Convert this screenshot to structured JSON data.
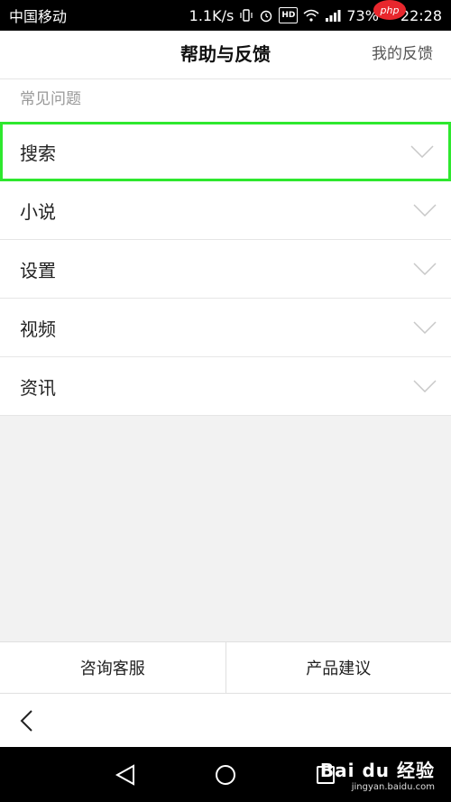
{
  "status_bar": {
    "carrier": "中国移动",
    "network_speed": "1.1K/s",
    "hd_label": "HD",
    "battery": "73%",
    "time": "22:28",
    "php_badge": "php"
  },
  "header": {
    "title": "帮助与反馈",
    "my_feedback": "我的反馈"
  },
  "faq": {
    "section_label": "常见问题",
    "items": [
      {
        "label": "搜索",
        "selected": true
      },
      {
        "label": "小说",
        "selected": false
      },
      {
        "label": "设置",
        "selected": false
      },
      {
        "label": "视频",
        "selected": false
      },
      {
        "label": "资讯",
        "selected": false
      }
    ]
  },
  "bottom_actions": {
    "consult_label": "咨询客服",
    "suggest_label": "产品建议"
  },
  "watermark": {
    "main": "Bai du 经验",
    "sub": "jingyan.baidu.com"
  },
  "colors": {
    "highlight_border": "#2ee82e",
    "php_badge": "#e8272d"
  },
  "icons": {
    "chevron": "chevron-down-icon",
    "back": "chevron-left-icon"
  }
}
